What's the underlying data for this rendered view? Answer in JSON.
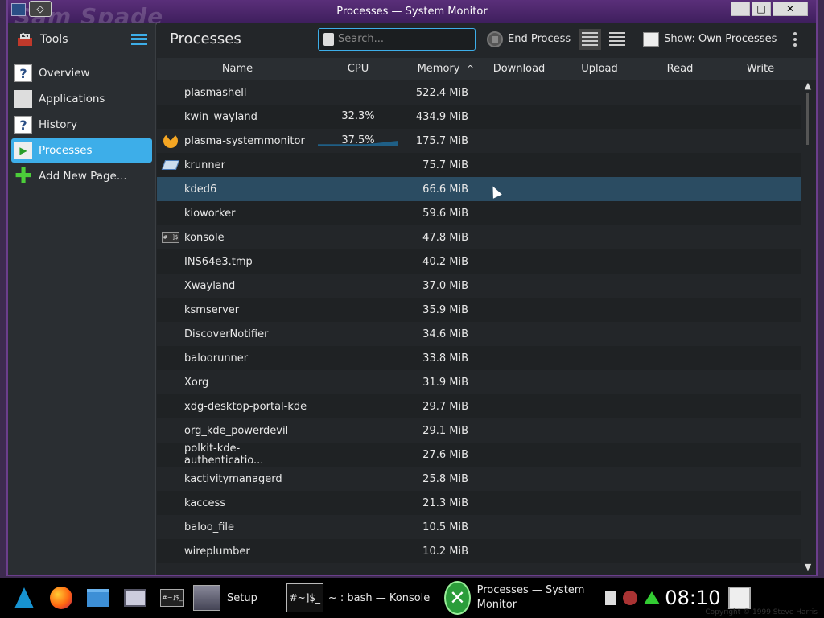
{
  "window": {
    "title": "Processes — System Monitor",
    "watermark": "Sam Spade"
  },
  "sidebar": {
    "tools_label": "Tools",
    "items": [
      {
        "label": "Overview",
        "icon": "help-page-icon",
        "active": false
      },
      {
        "label": "Applications",
        "icon": "applications-grid-icon",
        "active": false
      },
      {
        "label": "History",
        "icon": "help-page-icon",
        "active": false
      },
      {
        "label": "Processes",
        "icon": "processes-icon",
        "active": true
      },
      {
        "label": "Add New Page...",
        "icon": "plus-icon",
        "active": false
      }
    ]
  },
  "toolbar": {
    "page_title": "Processes",
    "search_placeholder": "Search...",
    "end_process_label": "End Process",
    "show_label": "Show: Own Processes"
  },
  "table": {
    "columns": [
      "Name",
      "CPU",
      "Memory",
      "Download",
      "Upload",
      "Read",
      "Write"
    ],
    "sort_column": "Memory",
    "rows": [
      {
        "name": "plasmashell",
        "cpu": "",
        "memory": "522.4 MiB",
        "icon": ""
      },
      {
        "name": "kwin_wayland",
        "cpu": "32.3%",
        "memory": "434.9 MiB",
        "icon": ""
      },
      {
        "name": "plasma-systemmonitor",
        "cpu": "37.5%",
        "memory": "175.7 MiB",
        "icon": "pac"
      },
      {
        "name": "krunner",
        "cpu": "",
        "memory": "75.7 MiB",
        "icon": "kr"
      },
      {
        "name": "kded6",
        "cpu": "",
        "memory": "66.6 MiB",
        "icon": "",
        "selected": true
      },
      {
        "name": "kioworker",
        "cpu": "",
        "memory": "59.6 MiB",
        "icon": ""
      },
      {
        "name": "konsole",
        "cpu": "",
        "memory": "47.8 MiB",
        "icon": "ks"
      },
      {
        "name": "INS64e3.tmp",
        "cpu": "",
        "memory": "40.2 MiB",
        "icon": ""
      },
      {
        "name": "Xwayland",
        "cpu": "",
        "memory": "37.0 MiB",
        "icon": ""
      },
      {
        "name": "ksmserver",
        "cpu": "",
        "memory": "35.9 MiB",
        "icon": ""
      },
      {
        "name": "DiscoverNotifier",
        "cpu": "",
        "memory": "34.6 MiB",
        "icon": ""
      },
      {
        "name": "baloorunner",
        "cpu": "",
        "memory": "33.8 MiB",
        "icon": ""
      },
      {
        "name": "Xorg",
        "cpu": "",
        "memory": "31.9 MiB",
        "icon": ""
      },
      {
        "name": "xdg-desktop-portal-kde",
        "cpu": "",
        "memory": "29.7 MiB",
        "icon": ""
      },
      {
        "name": "org_kde_powerdevil",
        "cpu": "",
        "memory": "29.1 MiB",
        "icon": ""
      },
      {
        "name": "polkit-kde-authenticatio...",
        "cpu": "",
        "memory": "27.6 MiB",
        "icon": ""
      },
      {
        "name": "kactivitymanagerd",
        "cpu": "",
        "memory": "25.8 MiB",
        "icon": ""
      },
      {
        "name": "kaccess",
        "cpu": "",
        "memory": "21.3 MiB",
        "icon": ""
      },
      {
        "name": "baloo_file",
        "cpu": "",
        "memory": "10.5 MiB",
        "icon": ""
      },
      {
        "name": "wireplumber",
        "cpu": "",
        "memory": "10.2 MiB",
        "icon": ""
      },
      {
        "name": "",
        "cpu": "",
        "memory": "",
        "icon": ""
      }
    ]
  },
  "taskbar": {
    "setup_label": "Setup",
    "konsole_label": "~ : bash — Konsole",
    "konsole_icon_text": "#~]$_",
    "sysmon_label": "Processes — System Monitor",
    "term_icon_text": "#~]$_",
    "clock": "08:10",
    "copyright": "Copyright © 1999 Steve Harris"
  },
  "colors": {
    "accent": "#3daee9",
    "window_frame": "#6b3e8c",
    "background": "#232629"
  }
}
